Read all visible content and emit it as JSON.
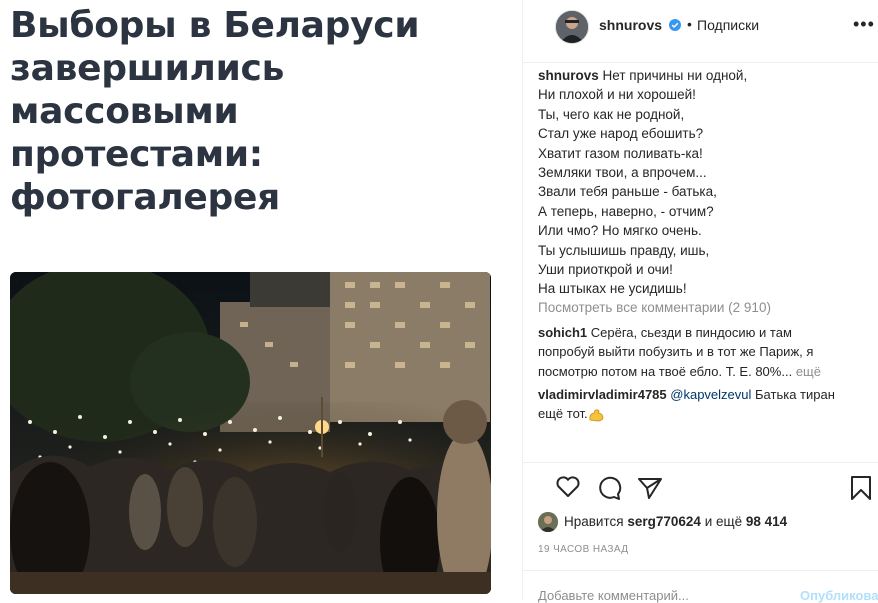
{
  "article": {
    "title_lines": [
      "Выборы в Беларуси",
      "завершились",
      "массовыми",
      "протестами:",
      "фотогалерея"
    ]
  },
  "post": {
    "username": "shnurovs",
    "dot": "•",
    "follow_label": "Подписки",
    "more_glyph": "•••",
    "caption_user": "shnurovs",
    "caption_lines": [
      "Нет причины ни одной,",
      "Ни плохой и ни хорошей!",
      "Ты, чего как не родной,",
      "Стал уже народ ебошить?",
      "Хватит газом поливать-ка!",
      "Земляки твои, а впрочем...",
      "Звали тебя раньше - батька,",
      "А теперь, наверно, - отчим?",
      "Или чмо? Но мягко очень.",
      "Ты услышишь правду, ишь,",
      "Уши приоткрой и очи!",
      "На штыках не усидишь!"
    ],
    "view_comments": "Посмотреть все комментарии (2 910)",
    "comments": [
      {
        "user": "sohich1",
        "text_lines": [
          "Серёга, сьезди в пиндосию и там",
          "попробуй выйти побузить и в тот же Париж, я",
          "посмотрю потом на твоё ебло. Т. Е. 80%..."
        ],
        "more": "ещё"
      },
      {
        "user": "vladimirvladimir4785",
        "mention": "@kapvelzevul",
        "text_lines": [
          "Батька тиран",
          "ещё тот."
        ],
        "emoji": "flexed-biceps"
      }
    ],
    "likes": {
      "prefix": "Нравится",
      "user": "serg770624",
      "middle": "и ещё",
      "count": "98 414"
    },
    "timestamp": "19 ЧАСОВ НАЗАД",
    "comment_placeholder": "Добавьте комментарий...",
    "publish_label": "Опубликовать"
  },
  "colors": {
    "link": "#00376b",
    "verified": "#3897f0",
    "publish": "#b2dffc",
    "muted": "#8e8e8e"
  }
}
